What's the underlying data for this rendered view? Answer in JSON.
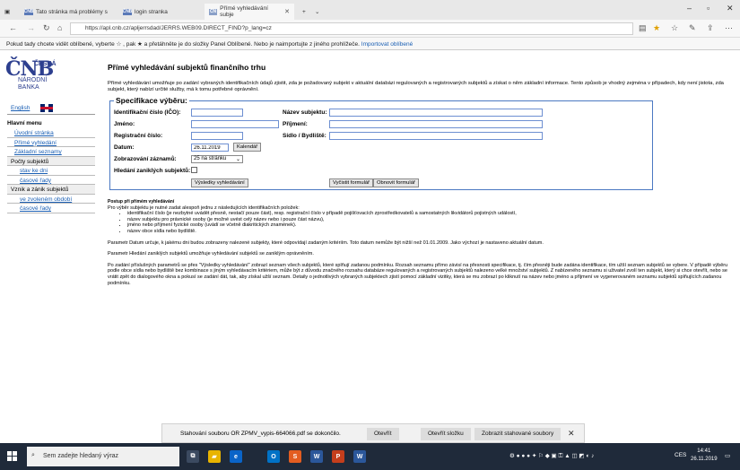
{
  "browser": {
    "tabs": [
      {
        "label": "Tato stránka má problémy s"
      },
      {
        "label": "login stranka"
      },
      {
        "label": "Přímé vyhledávání subje"
      }
    ],
    "url": "https://apl.cnb.cz/apljerrsdad/JERRS.WEB09.DIRECT_FIND?p_lang=cz",
    "favbar_text": "Pokud tady chcete vidět oblíbené, vyberte ☆ , pak ★ a přetáhněte je do složky Panel Oblíbené. Nebo je naimportujte z jiného prohlížeče.",
    "favbar_link": "Importovat oblíbené",
    "icons": [
      "back-icon",
      "forward-icon",
      "refresh-icon",
      "home-icon",
      "reading-view-icon",
      "favorite-star-icon",
      "favorites-hub-icon",
      "pen-icon",
      "share-icon",
      "more-icon"
    ]
  },
  "logo": {
    "mark": "ČNB",
    "line1": "ČESKÁ",
    "line2": "NÁRODNÍ",
    "line3": "BANKA"
  },
  "sidebar": {
    "english": "English",
    "menu_title": "Hlavní menu",
    "items": [
      {
        "label": "Úvodní stránka"
      },
      {
        "label": "Přímé vyhledání"
      },
      {
        "label": "Základní seznamy"
      },
      {
        "label": "Počty subjektů"
      },
      {
        "label": "stav ke dni"
      },
      {
        "label": "časové řady"
      },
      {
        "label": "Vznik a zánik subjektů"
      },
      {
        "label": "ve zvoleném období"
      },
      {
        "label": "časové řady"
      }
    ]
  },
  "main": {
    "title": "Přímé vyhledávání subjektů finančního trhu",
    "intro": "Přímé vyhledávání umožňuje po zadání vybraných identifikačních údajů zjistit, zda je požadovaný subjekt v aktuální databázi regulovaných a registrovaných subjektů a získat o něm základní informace. Tento způsob je vhodný zejména v případech, kdy není jistota, zda subjekt, který nabízí určité služby, má k tomu potřebné oprávnění."
  },
  "form": {
    "legend": "Specifikace výběru:",
    "ico_label": "Identifikační číslo (IČO):",
    "name_label": "Název subjektu:",
    "first_label": "Jméno:",
    "last_label": "Příjmení:",
    "reg_label": "Registrační číslo:",
    "seat_label": "Sídlo / Bydliště:",
    "date_label": "Datum:",
    "date_value": "26.11.2019",
    "calendar_btn": "Kalendář",
    "display_label": "Zobrazování záznamů:",
    "display_value": "25 na stránku",
    "closed_label": "Hledání zaniklých subjektů:",
    "results_btn": "Výsledky vyhledávání",
    "clear_btn": "Vyčistit formulář",
    "refresh_btn": "Obnovit formulář"
  },
  "help": {
    "title": "Postup při přímém vyhledávání",
    "lead": "Pro výběr subjektu je nutné zadat alespoň jednu z následujících identifikačních položek:",
    "bullets": [
      "identifikační číslo (je nezbytné uvádět přesně, nestačí pouze část), resp. registrační číslo v případě pojišťovacích zprostředkovatelů a samostatných likvidátorů pojistných událostí,",
      "název subjektu pro právnické osoby (je možné uvést celý název nebo i pouze část názvu),",
      "jméno nebo příjmení fyzické osoby (uvádí se včetně diakritických znamének).",
      "název obce sídla nebo bydliště."
    ],
    "p1": "Parametr Datum určuje, k jakému dni budou zobrazeny nalezené subjekty, které odpovídají zadaným kritériím. Toto datum nemůže být nižší než 01.01.2009. Jako výchozí je nastaveno aktuální datum.",
    "p2": "Parametr Hledání zaniklých subjektů umožňuje vyhledávání subjektů se zaniklým oprávněním.",
    "p3": "Po zadání příslušných parametrů se přes \"Výsledky vyhledávání\" zobrazí seznam všech subjektů, které splňují zadanou podmínku. Rozsah seznamu přímo závisí na přesnosti specifikace, tj. čím přesněji bude zadána identifikace, tím užší seznam subjektů se vybere. V případě výběru podle obce sídla nebo bydliště bez kombinace s jiným vyhledávacím kritériem, může být z důvodu značného rozsahu databáze regulovaných a registrovaných subjektů nalezeno velké množství subjektů. Z nabízeného seznamu si uživatel zvolí ten subjekt, který si chce otevřít, nebo se vrátit zpět do dialogového okna a pokusí se zadání dát, tak, aby získal užší seznam. Detaily o jednotlivých vybraných subjektech zjistí pomocí základní vizitky, která se mu zobrazí po kliknutí na název nebo jméno a příjmení ve vygenerovaném seznamu subjektů splňujících zadanou podmínku."
  },
  "download": {
    "message": "Stahování souboru OR ZPMV_vypis-664066.pdf se dokončilo.",
    "open": "Otevřít",
    "open_folder": "Otevřít složku",
    "show": "Zobrazit stahované soubory"
  },
  "taskbar": {
    "search_placeholder": "Sem zadejte hledaný výraz",
    "lang": "CES",
    "time": "14:41",
    "date": "26.11.2019"
  }
}
